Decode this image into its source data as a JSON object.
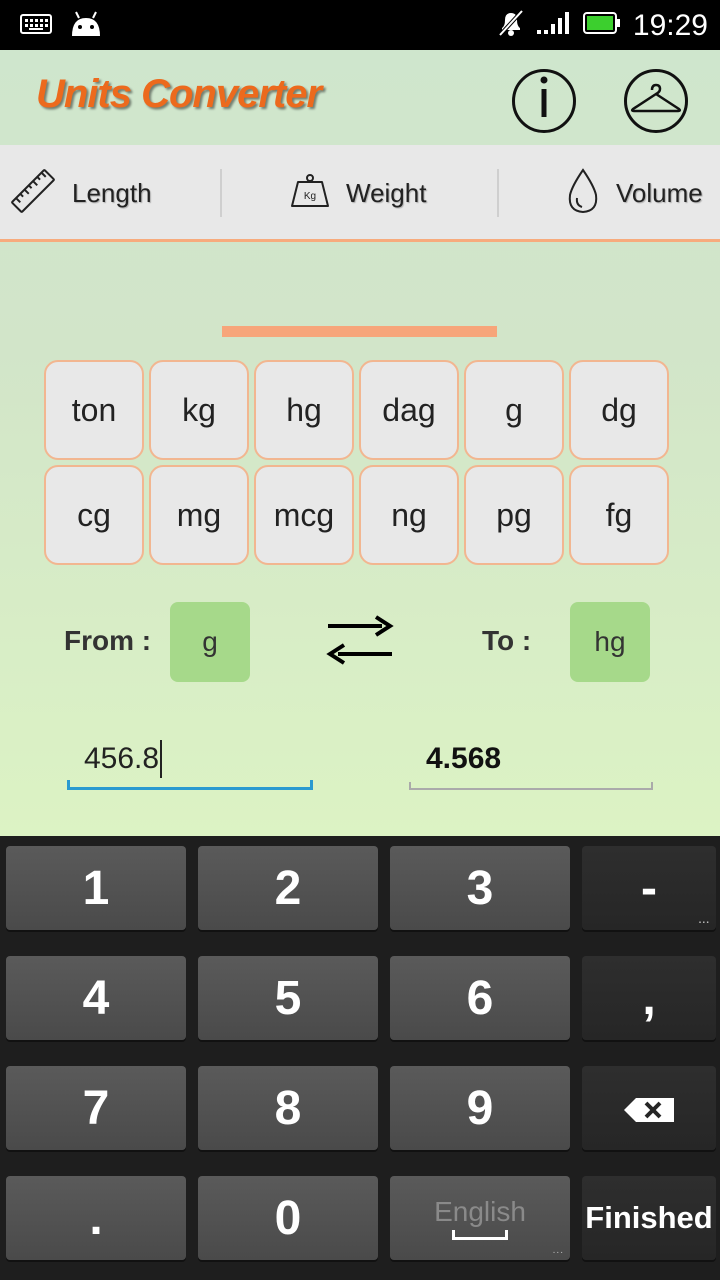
{
  "status_bar": {
    "time": "19:29",
    "left_icons": [
      "keyboard-icon",
      "android-icon"
    ],
    "right_icons": [
      "mute-icon",
      "signal-icon",
      "battery-icon"
    ]
  },
  "header": {
    "title": "Units Converter",
    "info_icon": "info-icon",
    "theme_icon": "hanger-icon"
  },
  "tabs": [
    {
      "label": "Length",
      "icon": "ruler-icon"
    },
    {
      "label": "Weight",
      "icon": "weight-icon",
      "icon_text": "Kg",
      "selected": true
    },
    {
      "label": "Volume",
      "icon": "drop-icon"
    }
  ],
  "units": [
    "ton",
    "kg",
    "hg",
    "dag",
    "g",
    "dg",
    "cg",
    "mg",
    "mcg",
    "ng",
    "pg",
    "fg"
  ],
  "conversion": {
    "from_label": "From :",
    "from_unit": "g",
    "to_label": "To :",
    "to_unit": "hg",
    "input_value": "456.8",
    "output_value": "4.568"
  },
  "keyboard": {
    "keys": [
      "1",
      "2",
      "3",
      "-",
      "4",
      "5",
      "6",
      ",",
      "7",
      "8",
      "9",
      "backspace",
      ".",
      "0",
      "English",
      "Finished"
    ],
    "more_dots": "...",
    "backspace_icon": "backspace-icon"
  },
  "colors": {
    "title": "#ec6a1d",
    "accent": "#f7a57a",
    "selected_unit": "#a6d98a",
    "input_underline": "#2a9ad0"
  }
}
